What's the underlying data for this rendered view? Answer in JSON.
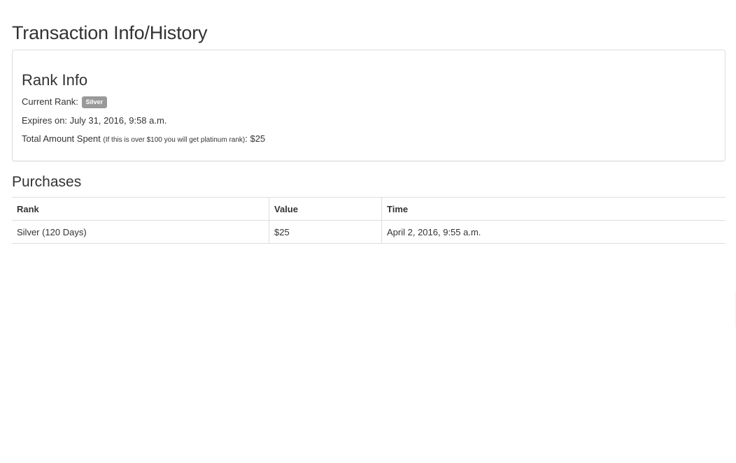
{
  "page": {
    "title": "Transaction Info/History"
  },
  "rank_info": {
    "heading": "Rank Info",
    "current_rank_label": "Current Rank:",
    "current_rank_badge": "Silver",
    "expires_label": "Expires on:",
    "expires_value": "July 31, 2016, 9:58 a.m.",
    "total_spent_label": "Total Amount Spent",
    "total_spent_note": "(If this is over $100 you will get platinum rank)",
    "total_spent_value": ": $25",
    "badge_color": "#999999"
  },
  "purchases": {
    "heading": "Purchases",
    "columns": [
      "Rank",
      "Value",
      "Time"
    ],
    "rows": [
      {
        "rank": "Silver (120 Days)",
        "value": "$25",
        "time": "April 2, 2016, 9:55 a.m."
      }
    ]
  }
}
